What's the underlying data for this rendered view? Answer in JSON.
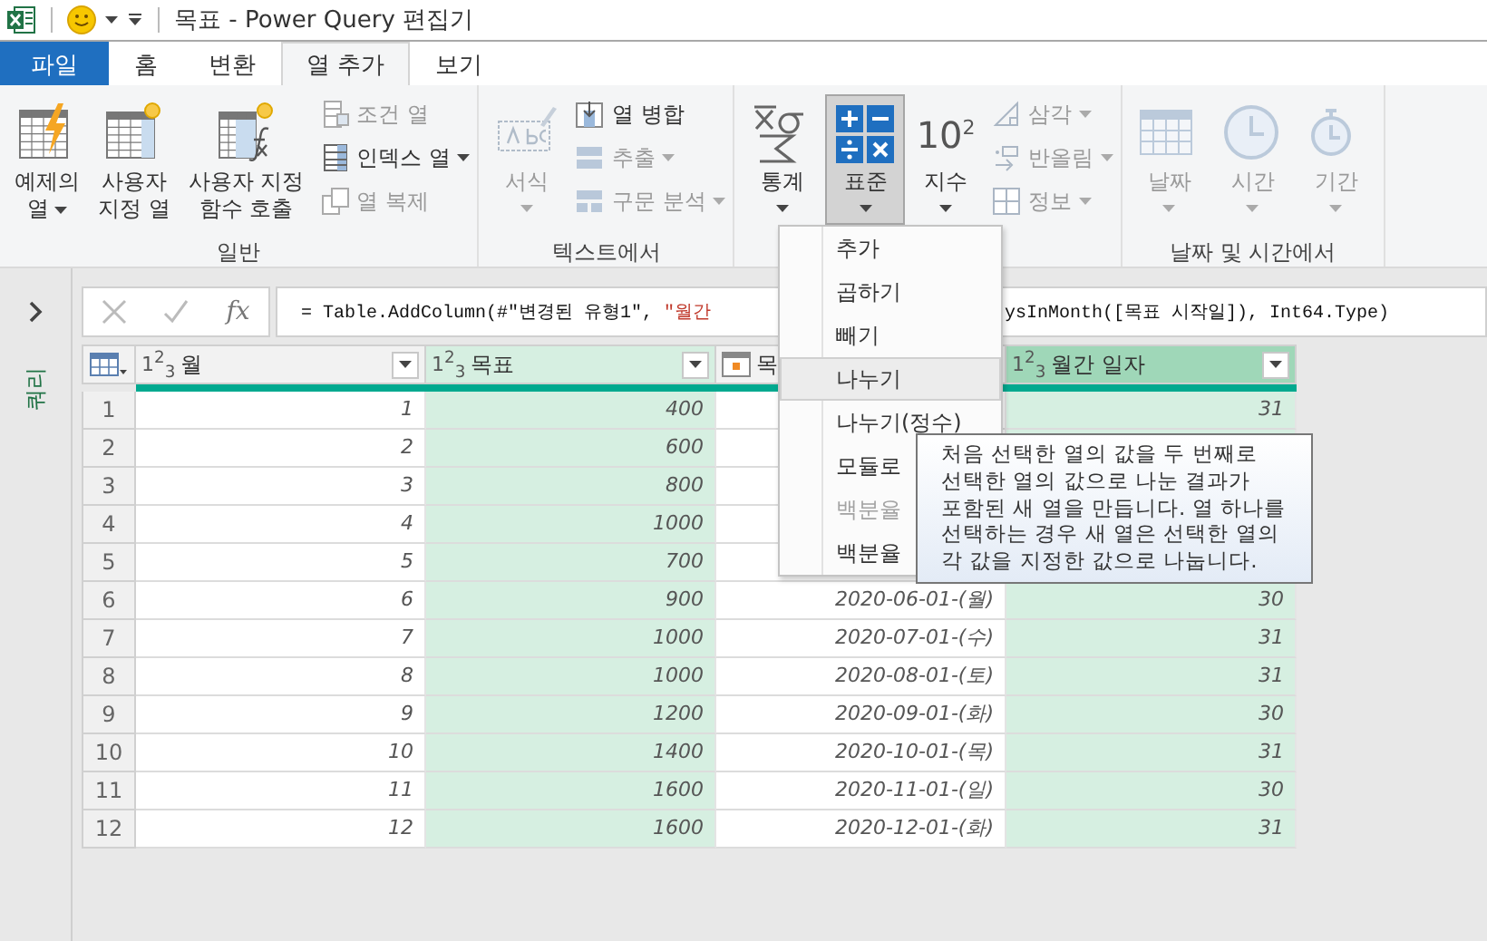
{
  "window": {
    "title": "목표 - Power Query 편집기"
  },
  "tabs": [
    {
      "label": "파일",
      "kind": "file",
      "selected": false
    },
    {
      "label": "홈",
      "kind": "tab",
      "selected": false
    },
    {
      "label": "변환",
      "kind": "tab",
      "selected": false
    },
    {
      "label": "열 추가",
      "kind": "tab",
      "selected": true
    },
    {
      "label": "보기",
      "kind": "tab",
      "selected": false
    }
  ],
  "ribbon": {
    "groups": [
      {
        "label": "일반",
        "large": [
          {
            "lines": [
              "예제의",
              "열"
            ],
            "dropdown": true,
            "disabled": false,
            "selected": false
          },
          {
            "lines": [
              "사용자",
              "지정 열"
            ],
            "dropdown": false,
            "disabled": false,
            "selected": false
          },
          {
            "lines": [
              "사용자 지정",
              "함수 호출"
            ],
            "dropdown": false,
            "disabled": false,
            "selected": false
          }
        ],
        "small": [
          {
            "label": "조건 열",
            "dropdown": false,
            "disabled": true
          },
          {
            "label": "인덱스 열",
            "dropdown": true,
            "disabled": false
          },
          {
            "label": "열 복제",
            "dropdown": false,
            "disabled": true
          }
        ]
      },
      {
        "label": "텍스트에서",
        "large": [
          {
            "lines": [
              "서식"
            ],
            "dropdown": true,
            "disabled": true,
            "selected": false
          }
        ],
        "small": [
          {
            "label": "열 병합",
            "dropdown": false,
            "disabled": false
          },
          {
            "label": "추출",
            "dropdown": true,
            "disabled": true
          },
          {
            "label": "구문 분석",
            "dropdown": true,
            "disabled": true
          }
        ]
      },
      {
        "large": [
          {
            "lines": [
              "통계"
            ],
            "dropdown": true,
            "disabled": false,
            "selected": false
          },
          {
            "lines": [
              "표준"
            ],
            "dropdown": true,
            "disabled": false,
            "selected": true
          },
          {
            "lines": [
              "지수"
            ],
            "icon_text": "10$^{2}$",
            "dropdown": true,
            "disabled": false,
            "selected": false
          }
        ],
        "small": [
          {
            "label": "삼각",
            "dropdown": true,
            "disabled": true
          },
          {
            "label": "반올림",
            "dropdown": true,
            "disabled": true
          },
          {
            "label": "정보",
            "dropdown": true,
            "disabled": true
          }
        ]
      },
      {
        "label": "날짜 및 시간에서",
        "large": [
          {
            "lines": [
              "날짜"
            ],
            "dropdown": true,
            "disabled": true,
            "selected": false
          },
          {
            "lines": [
              "시간"
            ],
            "dropdown": true,
            "disabled": true,
            "selected": false
          },
          {
            "lines": [
              "기간"
            ],
            "dropdown": true,
            "disabled": true,
            "selected": false
          }
        ]
      }
    ]
  },
  "query_pane": {
    "label": "쿼리"
  },
  "formula_bar": {
    "function_label": "fx",
    "before": [
      {
        "text": "= Table.AddColumn(#\"변경된 유형1\", ",
        "kind": "code"
      },
      {
        "text": "\"월간",
        "kind": "string"
      }
    ],
    "after": [
      {
        "text": "ysInMonth([목표 시작일]), Int64.Type)",
        "kind": "code"
      }
    ]
  },
  "table": {
    "columns": [
      {
        "name": "월",
        "kind": "number",
        "type": "1$^{2}$$_{3}$",
        "selected": false
      },
      {
        "name": "목표",
        "kind": "number",
        "type": "1$^{2}$$_{3}$",
        "selected": true
      },
      {
        "name": "목",
        "kind": "date",
        "selected": false
      },
      {
        "name": "월간 일자",
        "kind": "number",
        "type": "1$^{2}$$_{3}$",
        "selected": true,
        "focused": true
      }
    ],
    "rows": [
      {
        "number": "1",
        "cells": [
          "1",
          "400",
          null,
          "31"
        ]
      },
      {
        "number": "2",
        "cells": [
          "2",
          "600",
          null,
          null
        ]
      },
      {
        "number": "3",
        "cells": [
          "3",
          "800",
          null,
          null
        ]
      },
      {
        "number": "4",
        "cells": [
          "4",
          "1000",
          null,
          null
        ]
      },
      {
        "number": "5",
        "cells": [
          "5",
          "700",
          null,
          null
        ]
      },
      {
        "number": "6",
        "cells": [
          "6",
          "900",
          "2020-06-01-(월)",
          "30"
        ]
      },
      {
        "number": "7",
        "cells": [
          "7",
          "1000",
          "2020-07-01-(수)",
          "31"
        ]
      },
      {
        "number": "8",
        "cells": [
          "8",
          "1000",
          "2020-08-01-(토)",
          "31"
        ]
      },
      {
        "number": "9",
        "cells": [
          "9",
          "1200",
          "2020-09-01-(화)",
          "30"
        ]
      },
      {
        "number": "10",
        "cells": [
          "10",
          "1400",
          "2020-10-01-(목)",
          "31"
        ]
      },
      {
        "number": "11",
        "cells": [
          "11",
          "1600",
          "2020-11-01-(일)",
          "30"
        ]
      },
      {
        "number": "12",
        "cells": [
          "12",
          "1600",
          "2020-12-01-(화)",
          "31"
        ]
      }
    ]
  },
  "menu": {
    "items": [
      {
        "label": "추가",
        "highlighted": false,
        "disabled": false
      },
      {
        "label": "곱하기",
        "highlighted": false,
        "disabled": false
      },
      {
        "label": "빼기",
        "highlighted": false,
        "disabled": false
      },
      {
        "label": "나누기",
        "highlighted": true,
        "disabled": false
      },
      {
        "label": "나누기(정수)",
        "highlighted": false,
        "disabled": false
      },
      {
        "label": "모듈로",
        "highlighted": false,
        "disabled": false
      },
      {
        "label": "백분율",
        "highlighted": false,
        "disabled": true
      },
      {
        "label": "백분율",
        "highlighted": false,
        "disabled": false
      }
    ]
  },
  "tooltip": {
    "text": "처음 선택한 열의 값을 두 번째로 선택한 열의 값으로 나눈 결과가 포함된 새 열을 만듭니다. 열 하나를 선택하는 경우 새 열은 선택한 열의 각 값을 지정한 값으로 나눕니다."
  }
}
